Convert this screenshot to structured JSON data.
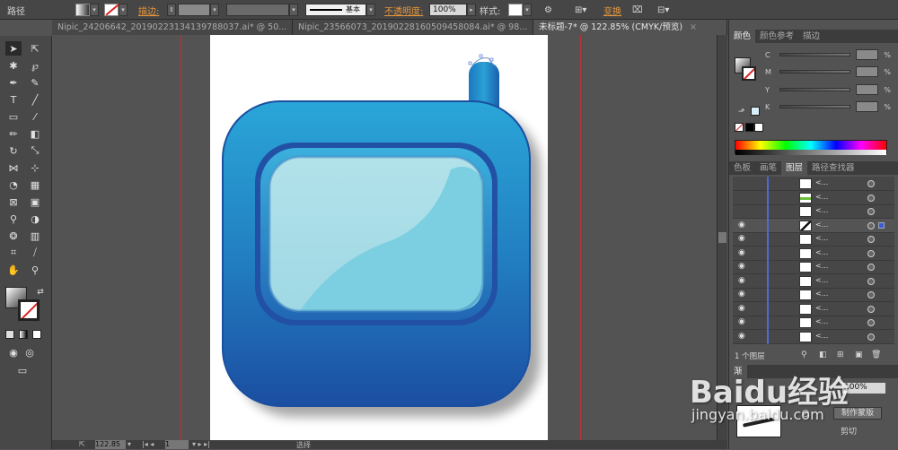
{
  "topbar": {
    "path_label": "路径",
    "stroke_label": "描边:",
    "stroke_style": "基本",
    "opacity_label": "不透明度:",
    "opacity_value": "100%",
    "style_label": "样式:",
    "transform_label": "变换"
  },
  "tabs": [
    {
      "label": "Nipic_24206642_20190223134139788037.ai* @ 50...",
      "close": "×"
    },
    {
      "label": "Nipic_23566073_20190228160509458084.ai* @ 98...",
      "close": "×"
    },
    {
      "label": "未标题-7* @ 122.85% (CMYK/预览)",
      "close": "×"
    }
  ],
  "color_panel": {
    "tabs": [
      "颜色",
      "颜色参考",
      "描边"
    ],
    "channels": [
      {
        "label": "C",
        "pct": "%"
      },
      {
        "label": "M",
        "pct": "%"
      },
      {
        "label": "Y",
        "pct": "%"
      },
      {
        "label": "K",
        "pct": "%"
      }
    ]
  },
  "layers_panel": {
    "tabs": [
      "色板",
      "画笔",
      "图层",
      "路径查找器"
    ],
    "row_label": "<...",
    "footer": "1 个图层",
    "rows": 12
  },
  "bottom_panel": {
    "tab": "渐",
    "value": "100%",
    "mask_button": "制作蒙版",
    "clip_label": "剪切"
  },
  "status": {
    "zoom": "122.85",
    "page": "1",
    "mode": "选择"
  },
  "watermark": {
    "brand": "Baidu经验",
    "url": "jingyan.baidu.com"
  },
  "colors": {
    "guide": "#b8333a",
    "device_top": "#2aa3d6",
    "device_bottom": "#1a4fa0",
    "screen": "#9fdbe6"
  }
}
